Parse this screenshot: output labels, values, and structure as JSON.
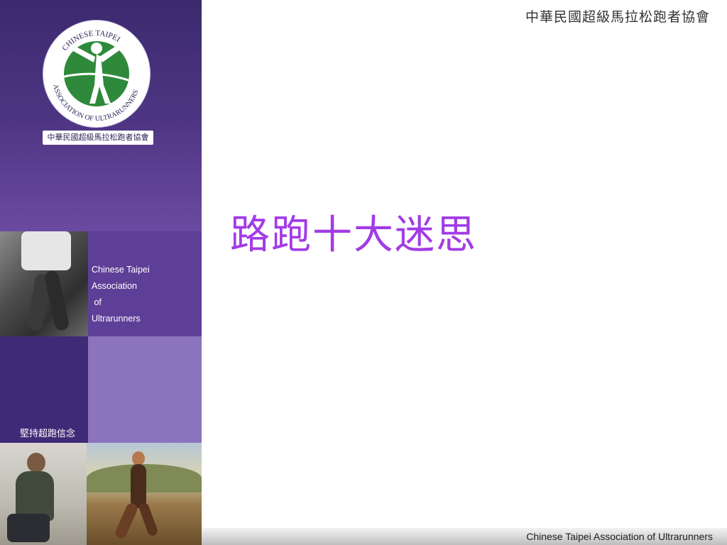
{
  "header": {
    "org_title_zh": "中華民國超級馬拉松跑者協會"
  },
  "sidebar": {
    "logo": {
      "ring_text_top": "CHINESE TAIPEI",
      "ring_text_bottom": "ASSOCIATION OF ULTRARUNNERS",
      "caption_zh": "中華民國超級馬拉松跑者協會"
    },
    "association_lines": [
      "Chinese Taipei",
      "Association",
      " of",
      "Ultrarunners"
    ],
    "motto_zh": "堅持超跑信念"
  },
  "slide": {
    "title_zh": "路跑十大迷思"
  },
  "footer": {
    "text": "Chinese Taipei Association of Ultrarunners"
  },
  "colors": {
    "purple_dark": "#3b2a6e",
    "purple_light": "#8b74bd",
    "title": "#a23be6"
  }
}
